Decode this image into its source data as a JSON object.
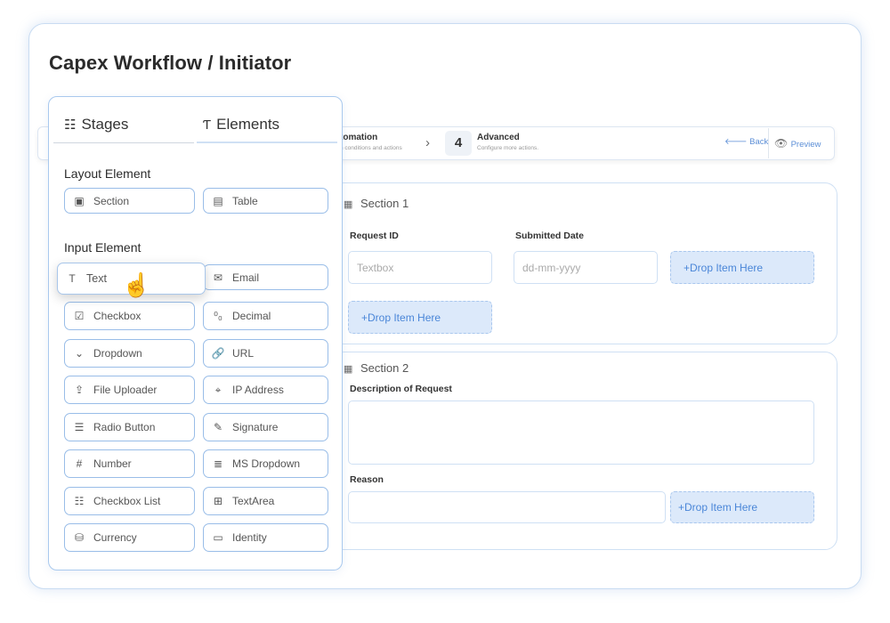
{
  "page": {
    "title": "Capex Workflow / Initiator"
  },
  "stepper": {
    "step3_title": "tomation",
    "step3_sub": "n conditions and actions",
    "step4_number": "4",
    "step4_title": "Advanced",
    "step4_sub": "Configure more actions.",
    "back_label": "Back",
    "preview_label": "Preview"
  },
  "panel": {
    "tabs": {
      "stages": "Stages",
      "elements": "Elements"
    },
    "layout_heading": "Layout Element",
    "layout_items": [
      {
        "label": "Section",
        "icon": "section-icon"
      },
      {
        "label": "Table",
        "icon": "table-icon"
      }
    ],
    "input_heading": "Input Element",
    "input_items": [
      {
        "label": "Text",
        "icon": "text-icon"
      },
      {
        "label": "Email",
        "icon": "email-icon"
      },
      {
        "label": "Checkbox",
        "icon": "checkbox-icon"
      },
      {
        "label": "Decimal",
        "icon": "decimal-icon"
      },
      {
        "label": "Dropdown",
        "icon": "dropdown-icon"
      },
      {
        "label": "URL",
        "icon": "link-icon"
      },
      {
        "label": "File Uploader",
        "icon": "file-upload-icon"
      },
      {
        "label": "IP Address",
        "icon": "location-pin-icon"
      },
      {
        "label": "Radio Button",
        "icon": "radio-list-icon"
      },
      {
        "label": "Signature",
        "icon": "signature-icon"
      },
      {
        "label": "Number",
        "icon": "number-icon"
      },
      {
        "label": "MS Dropdown",
        "icon": "multi-select-icon"
      },
      {
        "label": "Checkbox List",
        "icon": "checkbox-list-icon"
      },
      {
        "label": "TextArea",
        "icon": "textarea-icon"
      },
      {
        "label": "Currency",
        "icon": "currency-icon"
      },
      {
        "label": "Identity",
        "icon": "identity-card-icon"
      }
    ]
  },
  "section1": {
    "title": "Section 1",
    "request_id_label": "Request ID",
    "request_id_placeholder": "Textbox",
    "submitted_date_label": "Submitted Date",
    "submitted_date_placeholder": "dd-mm-yyyy",
    "drop_label": "+Drop Item Here"
  },
  "section2": {
    "title": "Section 2",
    "description_label": "Description of Request",
    "reason_label": "Reason",
    "drop_label": "+Drop Item Here"
  }
}
